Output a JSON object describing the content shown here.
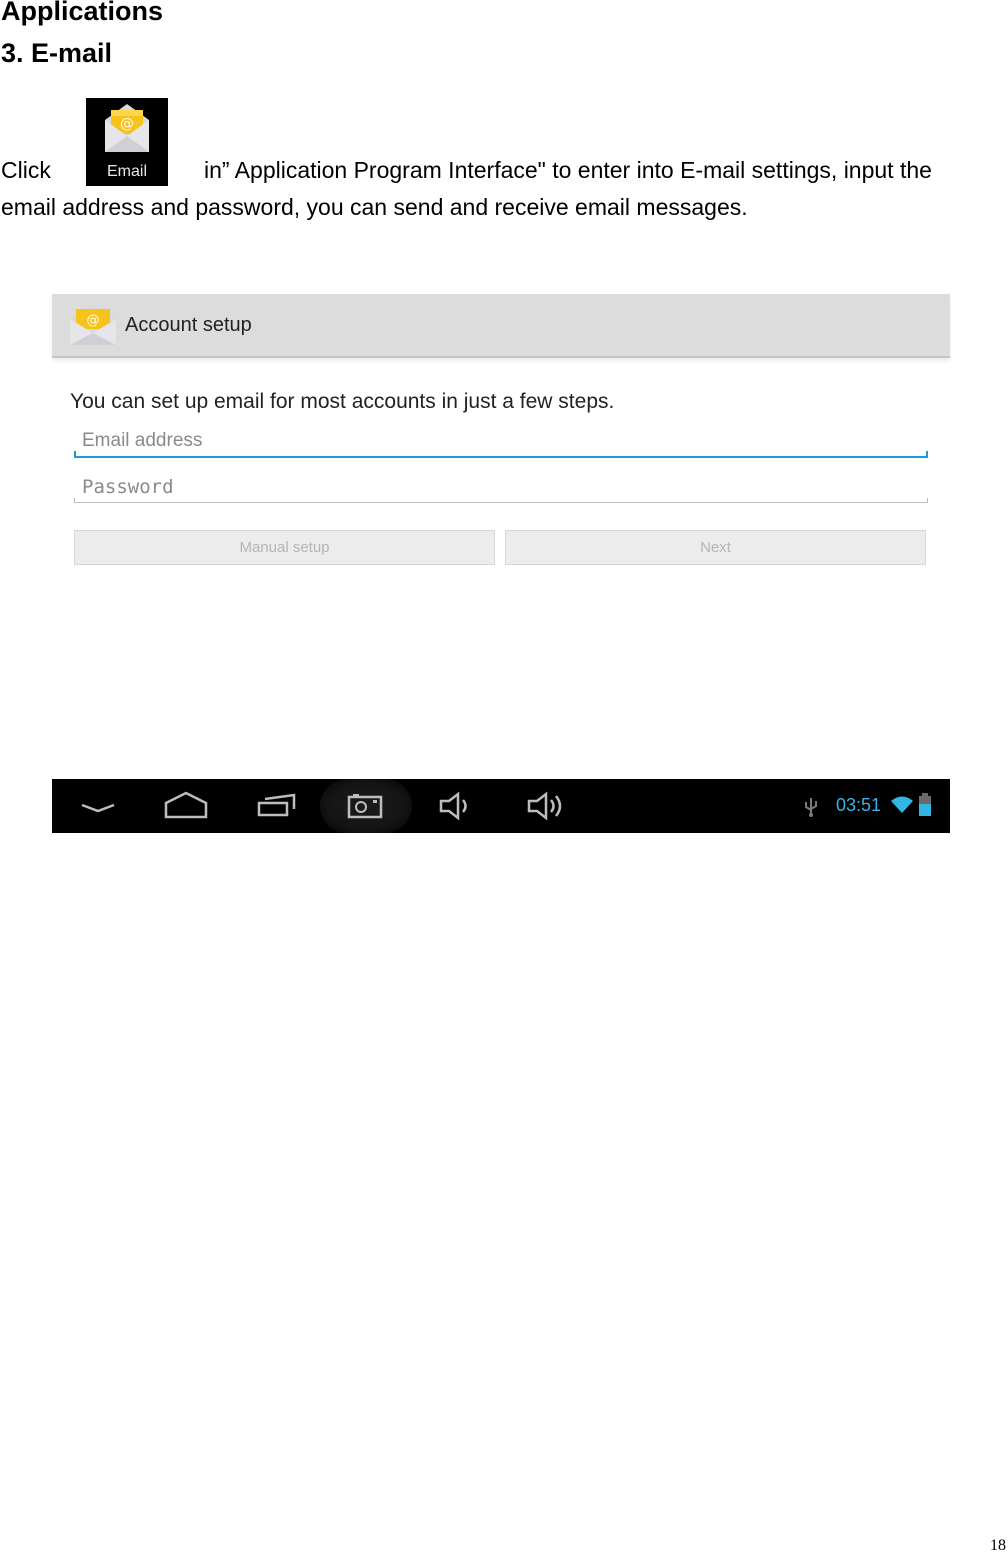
{
  "document": {
    "section_title": "Applications",
    "subsection_title": "3. E-mail",
    "paragraph": {
      "before_icon": "Click",
      "after_icon": "in” Application Program Interface\" to enter into E-mail settings, input the",
      "line2": "email address and password, you can send and receive email messages."
    },
    "inline_app_icon": {
      "icon": "email-app-icon",
      "label": "Email"
    },
    "page_number": "18"
  },
  "screenshot": {
    "action_bar": {
      "icon": "email-envelope-icon",
      "title": "Account setup"
    },
    "intro_text": "You can set up email for most accounts in just a few steps.",
    "email_field": {
      "placeholder": "Email address",
      "value": ""
    },
    "password_field": {
      "placeholder": "Password",
      "value": ""
    },
    "buttons": {
      "manual_setup": "Manual setup",
      "next": "Next"
    },
    "navigation_bar": {
      "buttons": [
        "back-icon",
        "home-icon",
        "recent-apps-icon",
        "screenshot-camera-icon",
        "volume-down-icon",
        "volume-up-icon"
      ],
      "status": {
        "usb": "usb-icon",
        "time": "03:51",
        "wifi": "wifi-icon",
        "battery": "battery-icon"
      }
    },
    "colors": {
      "accent": "#33b5e5",
      "focus_underline": "#1d9ad0",
      "action_bar": "#dcdcdc"
    }
  }
}
